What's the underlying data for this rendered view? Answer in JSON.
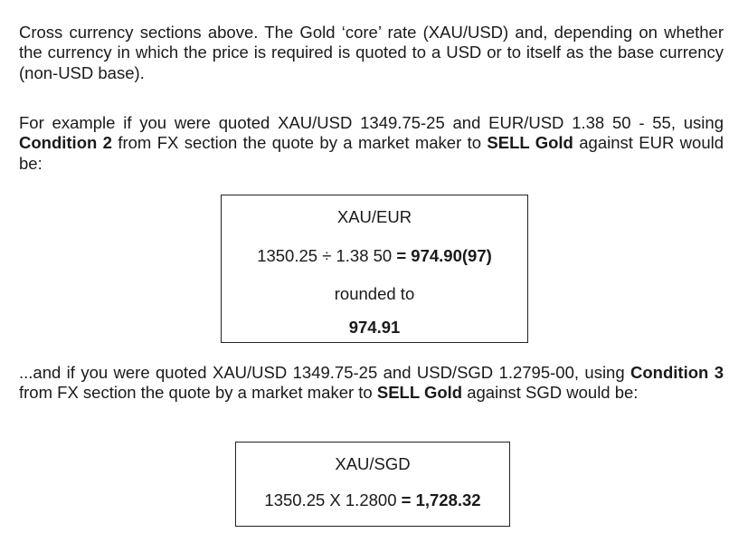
{
  "paragraph1": {
    "text": "Cross currency sections above. The Gold ‘core’ rate (XAU/USD) and, depending on whether the currency in which the price is required is quoted to a USD or to itself as the base currency (non-USD base)."
  },
  "paragraph2": {
    "text_a": "For example if you were quoted XAU/USD 1349.75-25 and EUR/USD 1.38 50 - 55, using ",
    "bold_a": "Condition 2",
    "text_b": " from FX section the quote by a market maker to ",
    "bold_b": "SELL Gold",
    "text_c": " against EUR would be:"
  },
  "box1": {
    "pair": "XAU/EUR",
    "formula": "1350.25 ÷ 1.38 50 ",
    "result": "= 974.90(97)",
    "rounded_label": "rounded to",
    "rounded_value": "974.91"
  },
  "paragraph3": {
    "text_a": "...and if you were quoted XAU/USD 1349.75-25 and USD/SGD 1.2795-00, using ",
    "bold_a": "Condition 3",
    "text_b": " from FX section the quote by a market maker to ",
    "bold_b": "SELL Gold",
    "text_c": " against SGD would be:"
  },
  "box2": {
    "pair": "XAU/SGD",
    "formula": "1350.25 X 1.2800 ",
    "result": "= 1,728.32"
  }
}
